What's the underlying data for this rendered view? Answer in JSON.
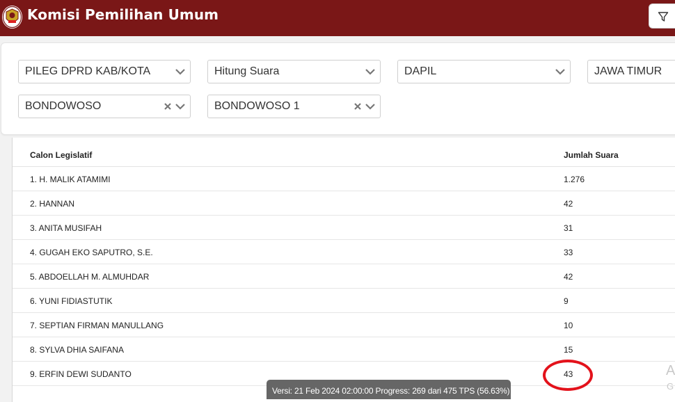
{
  "header": {
    "title": "Komisi Pemilihan Umum",
    "bg_color": "#7a1717",
    "logo_icon": "kpu-logo-icon",
    "filter_icon": "filter-icon"
  },
  "filters": {
    "election_type": "PILEG DPRD KAB/KOTA",
    "mode": "Hitung Suara",
    "level": "DAPIL",
    "province": "JAWA TIMUR",
    "regency": "BONDOWOSO",
    "district": "BONDOWOSO 1"
  },
  "table": {
    "headers": {
      "candidate": "Calon Legislatif",
      "votes": "Jumlah Suara"
    },
    "rows": [
      {
        "candidate": "1. H. MALIK ATAMIMI",
        "votes": "1.276"
      },
      {
        "candidate": "2. HANNAN",
        "votes": "42"
      },
      {
        "candidate": "3. ANITA MUSIFAH",
        "votes": "31"
      },
      {
        "candidate": "4. GUGAH EKO SAPUTRO, S.E.",
        "votes": "33"
      },
      {
        "candidate": "5. ABDOELLAH M. ALMUHDAR",
        "votes": "42"
      },
      {
        "candidate": "6. YUNI FIDIASTUTIK",
        "votes": "9"
      },
      {
        "candidate": "7. SEPTIAN FIRMAN MANULLANG",
        "votes": "10"
      },
      {
        "candidate": "8. SYLVA DHIA SAIFANA",
        "votes": "15"
      },
      {
        "candidate": "9. ERFIN DEWI SUDANTO",
        "votes": "43"
      }
    ]
  },
  "status_bar": {
    "text": "Versi: 21 Feb 2024 02:00:00 Progress: 269 dari 475 TPS (56.63%)"
  },
  "watermark": {
    "line1": "A",
    "line2": "G"
  },
  "annotation": {
    "highlight_color": "#e3121b"
  }
}
